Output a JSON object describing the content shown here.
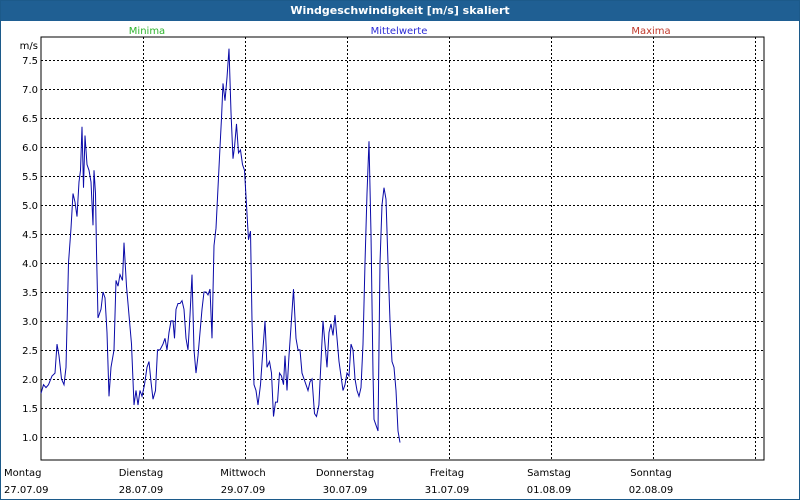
{
  "window": {
    "title": "Windgeschwindigkeit [m/s] skaliert"
  },
  "legend": [
    {
      "label": "Minima",
      "color": "#2fb52f"
    },
    {
      "label": "Mittelwerte",
      "color": "#2b2bd6"
    },
    {
      "label": "Maxima",
      "color": "#c0392b"
    }
  ],
  "chart_data": {
    "type": "line",
    "title": "Windgeschwindigkeit [m/s] skaliert",
    "ylabel": "m/s",
    "ylim": [
      0.6,
      7.9
    ],
    "xlim": [
      0,
      7
    ],
    "yticks": [
      "1.0",
      "1.5",
      "2.0",
      "2.5",
      "3.0",
      "3.5",
      "4.0",
      "4.5",
      "5.0",
      "5.5",
      "6.0",
      "6.5",
      "7.0",
      "7.5"
    ],
    "xticks": [
      {
        "day": "Montag",
        "date": "27.07.09"
      },
      {
        "day": "Dienstag",
        "date": "28.07.09"
      },
      {
        "day": "Mittwoch",
        "date": "29.07.09"
      },
      {
        "day": "Donnerstag",
        "date": "30.07.09"
      },
      {
        "day": "Freitag",
        "date": "31.07.09"
      },
      {
        "day": "Samstag",
        "date": "01.08.09"
      },
      {
        "day": "Sonntag",
        "date": "02.08.09"
      }
    ],
    "grid": true,
    "series": [
      {
        "name": "Mittelwerte",
        "color": "#0a0aa8",
        "points": [
          [
            0.0,
            1.75
          ],
          [
            0.025,
            1.9
          ],
          [
            0.049,
            1.85
          ],
          [
            0.074,
            1.9
          ],
          [
            0.108,
            2.05
          ],
          [
            0.137,
            2.1
          ],
          [
            0.157,
            2.6
          ],
          [
            0.176,
            2.4
          ],
          [
            0.201,
            2.0
          ],
          [
            0.225,
            1.9
          ],
          [
            0.245,
            2.2
          ],
          [
            0.27,
            4.0
          ],
          [
            0.294,
            4.6
          ],
          [
            0.314,
            5.2
          ],
          [
            0.333,
            5.05
          ],
          [
            0.353,
            4.8
          ],
          [
            0.373,
            5.4
          ],
          [
            0.387,
            5.6
          ],
          [
            0.402,
            6.35
          ],
          [
            0.417,
            5.3
          ],
          [
            0.431,
            6.2
          ],
          [
            0.451,
            5.7
          ],
          [
            0.471,
            5.6
          ],
          [
            0.49,
            5.4
          ],
          [
            0.51,
            4.65
          ],
          [
            0.52,
            5.6
          ],
          [
            0.534,
            5.2
          ],
          [
            0.544,
            4.2
          ],
          [
            0.559,
            3.05
          ],
          [
            0.588,
            3.2
          ],
          [
            0.608,
            3.5
          ],
          [
            0.627,
            3.4
          ],
          [
            0.647,
            2.8
          ],
          [
            0.667,
            1.7
          ],
          [
            0.686,
            2.2
          ],
          [
            0.716,
            2.5
          ],
          [
            0.735,
            3.7
          ],
          [
            0.755,
            3.6
          ],
          [
            0.775,
            3.8
          ],
          [
            0.799,
            3.7
          ],
          [
            0.814,
            4.35
          ],
          [
            0.838,
            3.6
          ],
          [
            0.863,
            3.1
          ],
          [
            0.887,
            2.6
          ],
          [
            0.912,
            1.55
          ],
          [
            0.931,
            1.8
          ],
          [
            0.951,
            1.55
          ],
          [
            0.971,
            1.8
          ],
          [
            0.99,
            1.7
          ],
          [
            1.015,
            1.9
          ],
          [
            1.039,
            2.2
          ],
          [
            1.059,
            2.3
          ],
          [
            1.078,
            1.95
          ],
          [
            1.098,
            1.65
          ],
          [
            1.123,
            1.8
          ],
          [
            1.142,
            2.5
          ],
          [
            1.167,
            2.5
          ],
          [
            1.196,
            2.6
          ],
          [
            1.216,
            2.7
          ],
          [
            1.235,
            2.5
          ],
          [
            1.255,
            2.8
          ],
          [
            1.275,
            3.0
          ],
          [
            1.294,
            3.0
          ],
          [
            1.309,
            2.7
          ],
          [
            1.324,
            3.2
          ],
          [
            1.343,
            3.3
          ],
          [
            1.363,
            3.3
          ],
          [
            1.382,
            3.35
          ],
          [
            1.402,
            3.2
          ],
          [
            1.422,
            2.7
          ],
          [
            1.441,
            2.5
          ],
          [
            1.461,
            3.1
          ],
          [
            1.48,
            3.8
          ],
          [
            1.5,
            2.5
          ],
          [
            1.52,
            2.1
          ],
          [
            1.539,
            2.4
          ],
          [
            1.559,
            2.8
          ],
          [
            1.578,
            3.2
          ],
          [
            1.598,
            3.5
          ],
          [
            1.618,
            3.5
          ],
          [
            1.637,
            3.45
          ],
          [
            1.657,
            3.55
          ],
          [
            1.676,
            2.7
          ],
          [
            1.696,
            4.3
          ],
          [
            1.716,
            4.6
          ],
          [
            1.735,
            5.3
          ],
          [
            1.755,
            6.0
          ],
          [
            1.77,
            6.5
          ],
          [
            1.784,
            7.1
          ],
          [
            1.804,
            6.8
          ],
          [
            1.824,
            7.2
          ],
          [
            1.843,
            7.7
          ],
          [
            1.863,
            6.6
          ],
          [
            1.882,
            5.8
          ],
          [
            1.897,
            6.0
          ],
          [
            1.917,
            6.4
          ],
          [
            1.936,
            5.9
          ],
          [
            1.956,
            5.95
          ],
          [
            1.975,
            5.7
          ],
          [
            1.995,
            5.6
          ],
          [
            2.015,
            5.0
          ],
          [
            2.034,
            4.4
          ],
          [
            2.054,
            4.55
          ],
          [
            2.069,
            3.0
          ],
          [
            2.088,
            1.9
          ],
          [
            2.108,
            1.8
          ],
          [
            2.127,
            1.55
          ],
          [
            2.152,
            1.9
          ],
          [
            2.172,
            2.4
          ],
          [
            2.196,
            3.0
          ],
          [
            2.216,
            2.2
          ],
          [
            2.24,
            2.3
          ],
          [
            2.26,
            2.1
          ],
          [
            2.279,
            1.35
          ],
          [
            2.299,
            1.6
          ],
          [
            2.319,
            1.6
          ],
          [
            2.338,
            2.1
          ],
          [
            2.358,
            2.05
          ],
          [
            2.377,
            1.9
          ],
          [
            2.392,
            2.4
          ],
          [
            2.412,
            1.8
          ],
          [
            2.431,
            2.4
          ],
          [
            2.451,
            2.9
          ],
          [
            2.475,
            3.55
          ],
          [
            2.5,
            2.7
          ],
          [
            2.52,
            2.5
          ],
          [
            2.539,
            2.5
          ],
          [
            2.559,
            2.1
          ],
          [
            2.578,
            2.0
          ],
          [
            2.598,
            1.9
          ],
          [
            2.618,
            1.8
          ],
          [
            2.637,
            1.95
          ],
          [
            2.657,
            2.0
          ],
          [
            2.681,
            1.4
          ],
          [
            2.701,
            1.35
          ],
          [
            2.725,
            1.55
          ],
          [
            2.745,
            2.3
          ],
          [
            2.765,
            3.0
          ],
          [
            2.784,
            2.6
          ],
          [
            2.804,
            2.2
          ],
          [
            2.824,
            2.8
          ],
          [
            2.843,
            2.95
          ],
          [
            2.863,
            2.75
          ],
          [
            2.882,
            3.1
          ],
          [
            2.902,
            2.7
          ],
          [
            2.922,
            2.3
          ],
          [
            2.941,
            2.05
          ],
          [
            2.961,
            1.8
          ],
          [
            2.98,
            1.9
          ],
          [
            3.0,
            2.1
          ],
          [
            3.02,
            2.05
          ],
          [
            3.039,
            2.6
          ],
          [
            3.059,
            2.5
          ],
          [
            3.078,
            2.0
          ],
          [
            3.098,
            1.8
          ],
          [
            3.118,
            1.7
          ],
          [
            3.137,
            1.85
          ],
          [
            3.157,
            2.6
          ],
          [
            3.176,
            4.0
          ],
          [
            3.196,
            5.2
          ],
          [
            3.216,
            6.1
          ],
          [
            3.235,
            4.5
          ],
          [
            3.255,
            2.1
          ],
          [
            3.265,
            1.3
          ],
          [
            3.284,
            1.2
          ],
          [
            3.304,
            1.1
          ],
          [
            3.324,
            4.0
          ],
          [
            3.343,
            5.0
          ],
          [
            3.363,
            5.3
          ],
          [
            3.382,
            5.1
          ],
          [
            3.402,
            4.0
          ],
          [
            3.422,
            3.0
          ],
          [
            3.441,
            2.3
          ],
          [
            3.461,
            2.2
          ],
          [
            3.48,
            1.8
          ],
          [
            3.5,
            1.1
          ],
          [
            3.52,
            0.9
          ]
        ]
      }
    ]
  }
}
